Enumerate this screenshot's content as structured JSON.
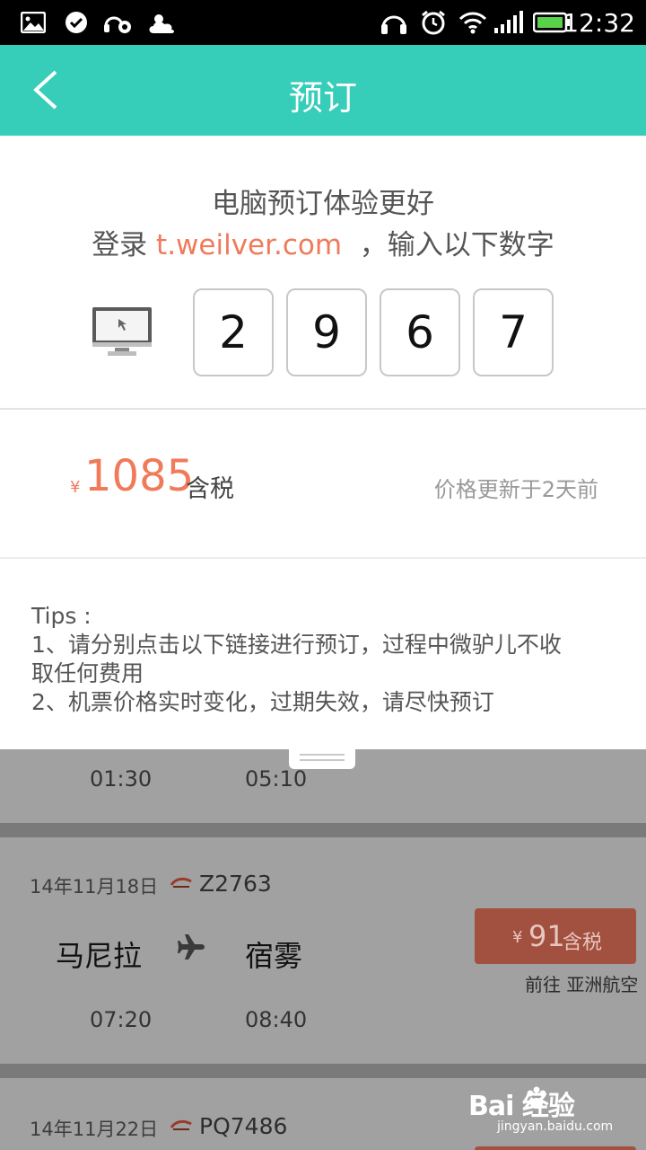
{
  "status_bar": {
    "time": "12:32",
    "icons": [
      "gallery-icon",
      "check-circle-icon",
      "headset-settings-icon",
      "weather-cloud-icon",
      "headphones-icon",
      "alarm-icon",
      "wifi-icon",
      "signal-icon",
      "battery-icon"
    ]
  },
  "header": {
    "title": "预订",
    "back_icon": "chevron-left-icon"
  },
  "pc_booking": {
    "line1": "电脑预订体验更好",
    "prefix": "登录 ",
    "url": "t.weilver.com",
    "suffix": "  ，输入以下数字",
    "monitor_icon": "monitor-icon",
    "code": [
      "2",
      "9",
      "6",
      "7"
    ]
  },
  "price": {
    "currency": "¥",
    "amount": "1085",
    "tax_label": "含税",
    "update_text": "价格更新于2天前"
  },
  "tips": {
    "title": "Tips :",
    "line1": "1、请分别点击以下链接进行预订，过程中微驴儿不收",
    "line2": "取任何费用",
    "line3": "2、机票价格实时变化，过期失效，请尽快预订"
  },
  "flights": [
    {
      "depart_time": "01:30",
      "arrive_time": "05:10"
    },
    {
      "date": "14年11月18日",
      "flight_no": "Z2763",
      "airline_logo_icon": "airasia-logo-icon",
      "from": "马尼拉",
      "to": "宿雾",
      "plane_icon": "airplane-icon",
      "depart_time": "07:20",
      "arrive_time": "08:40",
      "price_currency": "¥",
      "price": "91",
      "price_tax": "含税",
      "airline": "前往 亚洲航空"
    },
    {
      "date": "14年11月22日",
      "flight_no": "PQ7486",
      "airline_logo_icon": "airasia-logo-icon"
    }
  ],
  "watermark": {
    "brand": "Bai  经验",
    "url": "jingyan.baidu.com"
  },
  "colors": {
    "header": "#36cdb9",
    "accent": "#f07a5a",
    "dim_card": "#a1a1a1",
    "dim_button": "#a2503f"
  }
}
